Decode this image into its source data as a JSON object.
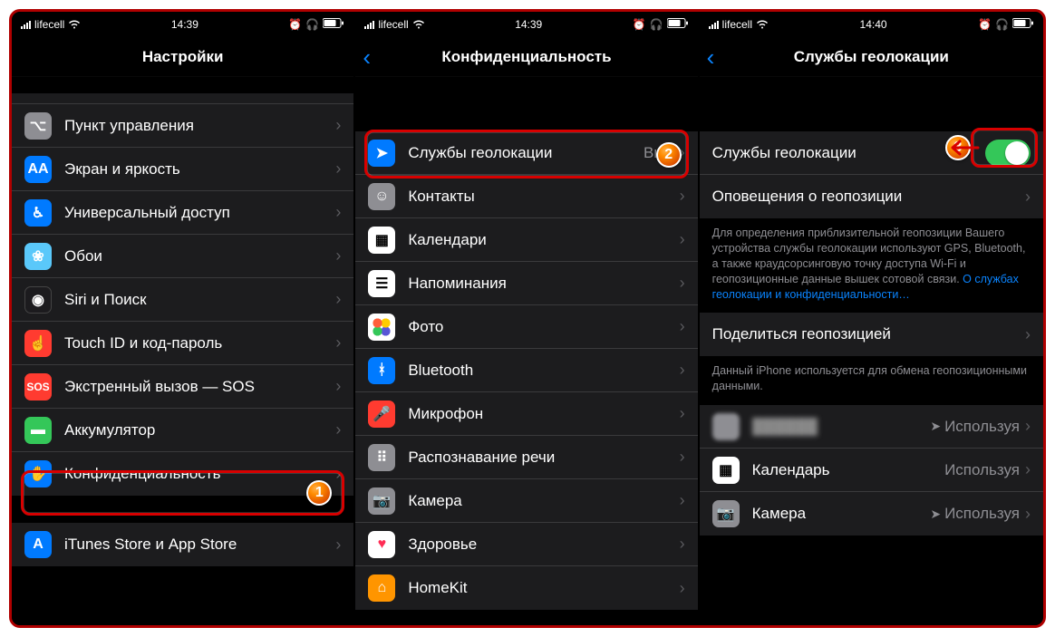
{
  "panel1": {
    "status": {
      "carrier": "lifecell",
      "time": "14:39"
    },
    "title": "Настройки",
    "rows": [
      {
        "label": "Пункт управления",
        "iconClass": "ic-gray",
        "glyph": "⌥"
      },
      {
        "label": "Экран и яркость",
        "iconClass": "ic-blue",
        "glyph": "AA"
      },
      {
        "label": "Универсальный доступ",
        "iconClass": "ic-blue",
        "glyph": "♿︎"
      },
      {
        "label": "Обои",
        "iconClass": "ic-teal",
        "glyph": "❀"
      },
      {
        "label": "Siri и Поиск",
        "iconClass": "ic-black",
        "glyph": "◉"
      },
      {
        "label": "Touch ID и код-пароль",
        "iconClass": "ic-red",
        "glyph": "☝"
      },
      {
        "label": "Экстренный вызов — SOS",
        "iconClass": "ic-red",
        "glyph": "SOS"
      },
      {
        "label": "Аккумулятор",
        "iconClass": "ic-green",
        "glyph": "▬"
      },
      {
        "label": "Конфиденциальность",
        "iconClass": "ic-blue",
        "glyph": "✋"
      }
    ],
    "rows_bottom": [
      {
        "label": "iTunes Store и App Store",
        "iconClass": "ic-blue",
        "glyph": "A"
      }
    ]
  },
  "panel2": {
    "status": {
      "carrier": "lifecell",
      "time": "14:39"
    },
    "title": "Конфиденциальность",
    "rows": [
      {
        "label": "Службы геолокации",
        "iconClass": "ic-blue",
        "glyph": "➤",
        "detail": "Вкл."
      },
      {
        "label": "Контакты",
        "iconClass": "ic-gray",
        "glyph": "☺"
      },
      {
        "label": "Календари",
        "iconClass": "ic-white",
        "glyph": "▦",
        "glyphDark": true
      },
      {
        "label": "Напоминания",
        "iconClass": "ic-white",
        "glyph": "☰",
        "glyphDark": true
      },
      {
        "label": "Фото",
        "iconClass": "ic-multi",
        "glyph": ""
      },
      {
        "label": "Bluetooth",
        "iconClass": "ic-blue",
        "glyph": "ᚼ"
      },
      {
        "label": "Микрофон",
        "iconClass": "ic-red",
        "glyph": "🎤"
      },
      {
        "label": "Распознавание речи",
        "iconClass": "ic-gray",
        "glyph": "⠿"
      },
      {
        "label": "Камера",
        "iconClass": "ic-gray",
        "glyph": "📷"
      },
      {
        "label": "Здоровье",
        "iconClass": "ic-white",
        "glyph": "♥",
        "glyphDark": true,
        "heartRed": true
      },
      {
        "label": "HomeKit",
        "iconClass": "ic-home",
        "glyph": "⌂"
      }
    ]
  },
  "panel3": {
    "status": {
      "carrier": "lifecell",
      "time": "14:40"
    },
    "title": "Службы геолокации",
    "toggle_row": {
      "label": "Службы геолокации"
    },
    "alerts_row": {
      "label": "Оповещения о геопозиции"
    },
    "info1_pre": "Для определения приблизительной геопозиции Вашего устройства службы геолокации используют GPS, Bluetooth, а также краудсорсинговую точку доступа Wi-Fi и геопозиционные данные вышек сотовой связи. ",
    "info1_link": "О службах геолокации и конфиденциальности…",
    "share_row": {
      "label": "Поделиться геопозицией"
    },
    "info2": "Данный iPhone используется для обмена геопозиционными данными.",
    "apps": [
      {
        "label": "██████",
        "detail": "Используя",
        "blurred": true,
        "arrow": true
      },
      {
        "label": "Календарь",
        "detail": "Используя",
        "iconClass": "ic-white",
        "glyph": "▦",
        "glyphDark": true
      },
      {
        "label": "Камера",
        "detail": "Используя",
        "iconClass": "ic-gray",
        "glyph": "📷",
        "arrow": true
      }
    ]
  },
  "badges": {
    "b1": "1",
    "b2": "2",
    "b3": "3"
  }
}
